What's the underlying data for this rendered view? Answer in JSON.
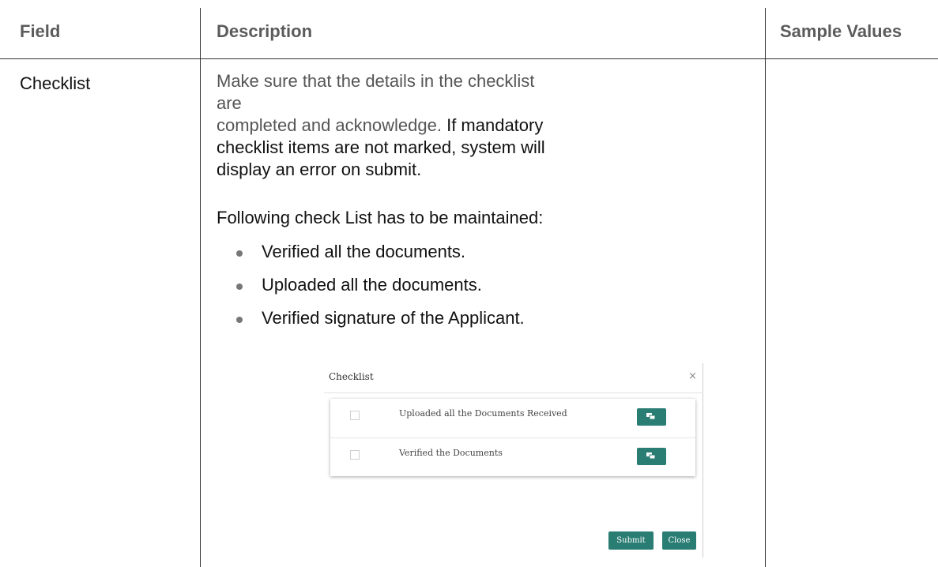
{
  "table": {
    "headers": [
      "Field",
      "Description",
      "Sample Values"
    ],
    "row": {
      "field": "Checklist",
      "description_part1": "Make sure that the details in the checklist are completed and acknowledge.",
      "description_part2": "If mandatory checklist items are not marked, system will display an error on submit.",
      "description_line1": "Make sure that the details in the checklist are",
      "description_line2a": "completed and acknowledge.",
      "description_line2b": " If mandatory",
      "description_line3": "checklist items are not marked, system will",
      "description_line4": "display an error on submit.",
      "following": "Following check List has to be maintained:",
      "items": [
        "Verified all the documents.",
        "Uploaded all the documents.",
        "Verified signature of the Applicant."
      ],
      "sample_values": ""
    }
  },
  "dialog": {
    "title": "Checklist",
    "close_glyph": "×",
    "items": [
      {
        "label": "Uploaded all the Documents Received",
        "checked": false
      },
      {
        "label": "Verified the Documents",
        "checked": false
      }
    ],
    "submit_label": "Submit",
    "close_label": "Close",
    "accent_color": "#2a7d73"
  }
}
